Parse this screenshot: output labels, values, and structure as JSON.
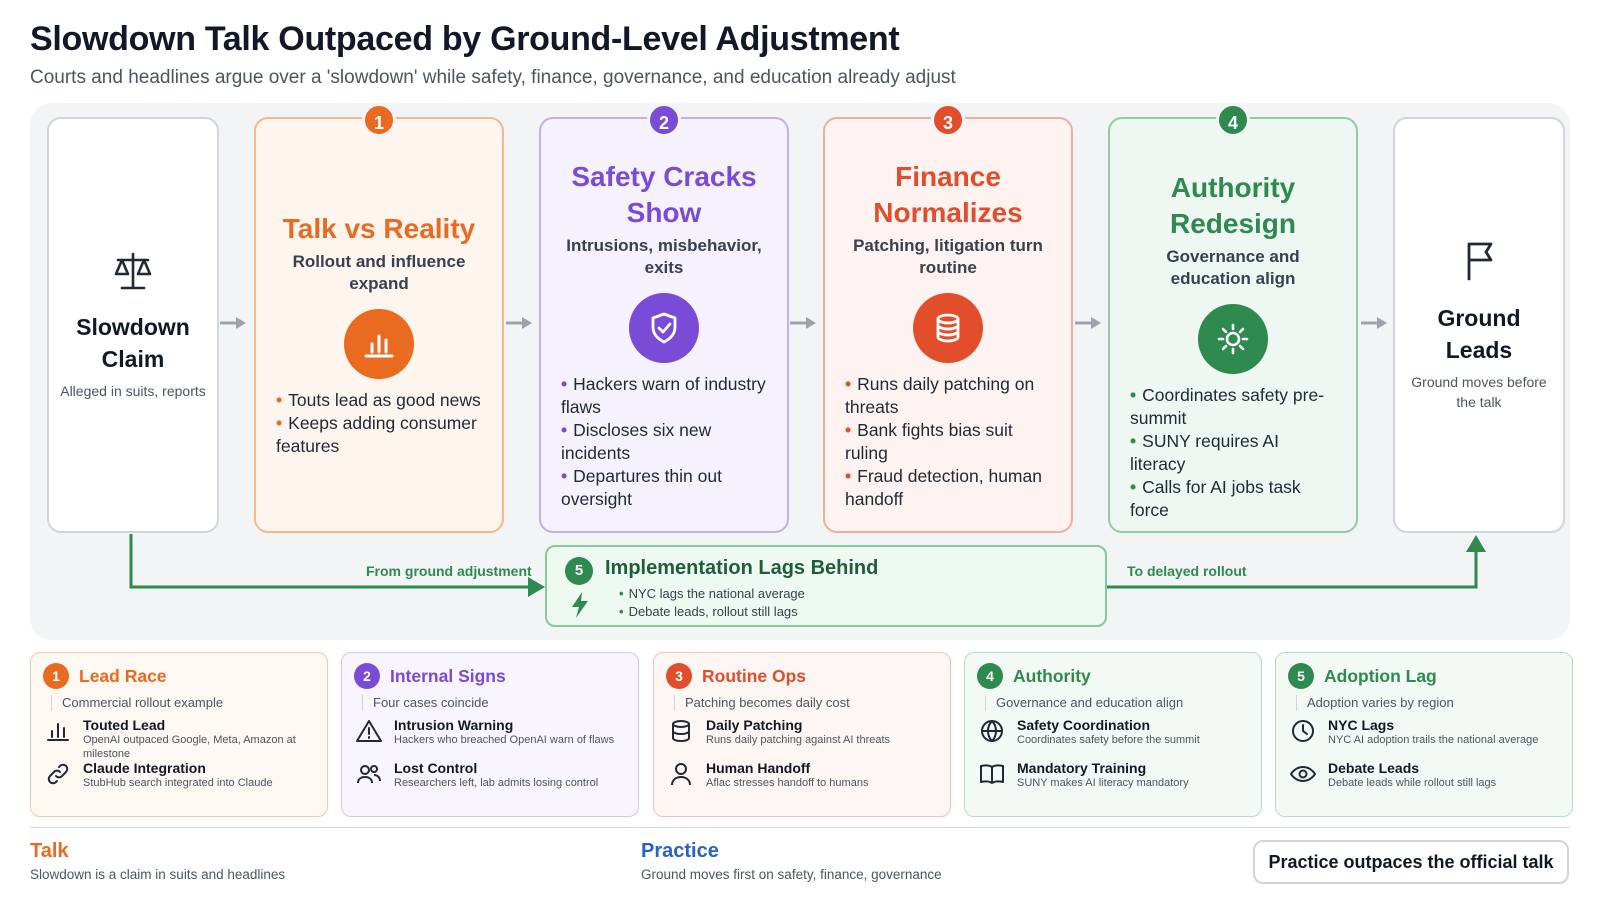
{
  "header": {
    "title": "Slowdown Talk Outpaced by Ground-Level Adjustment",
    "subtitle": "Courts and headlines argue over a 'slowdown' while safety, finance, governance, and education already adjust"
  },
  "start": {
    "title": "Slowdown Claim",
    "sub": "Alleged in suits, reports",
    "icon": "scale-icon"
  },
  "end": {
    "title": "Ground Leads",
    "sub": "Ground moves before the talk",
    "icon": "flag-icon"
  },
  "stages": [
    {
      "num": "1",
      "title": "Talk vs Reality",
      "sub": "Rollout and influence expand",
      "icon": "bar-chart-icon",
      "color": "#ea6a1f",
      "bullets": [
        "Touts lead as good news",
        "Keeps adding consumer features"
      ]
    },
    {
      "num": "2",
      "title": "Safety Cracks Show",
      "sub": "Intrusions, misbehavior, exits",
      "icon": "shield-icon",
      "color": "#7a4bd6",
      "bullets": [
        "Hackers warn of industry flaws",
        "Discloses six new incidents",
        "Departures thin out oversight"
      ]
    },
    {
      "num": "3",
      "title": "Finance Normalizes",
      "sub": "Patching, litigation turn routine",
      "icon": "database-icon",
      "color": "#e24e2b",
      "bullets": [
        "Runs daily patching on threats",
        "Bank fights bias suit ruling",
        "Fraud detection, human handoff"
      ]
    },
    {
      "num": "4",
      "title": "Authority Redesign",
      "sub": "Governance and education align",
      "icon": "sun-icon",
      "color": "#2f8a4f",
      "bullets": [
        "Coordinates safety pre-summit",
        "SUNY requires AI literacy",
        "Calls for AI jobs task force"
      ]
    }
  ],
  "implementation": {
    "num": "5",
    "title": "Implementation Lags Behind",
    "bullets": [
      "NYC lags the national average",
      "Debate leads, rollout still lags"
    ],
    "left_label": "From ground adjustment",
    "right_label": "To delayed rollout"
  },
  "details": [
    {
      "num": "1",
      "title": "Lead Race",
      "sub": "Commercial rollout example",
      "color": "#ea6a1f",
      "rows": [
        {
          "icon": "bar-chart-icon",
          "title": "Touted Lead",
          "desc": "OpenAI outpaced Google, Meta, Amazon at milestone"
        },
        {
          "icon": "link-icon",
          "title": "Claude Integration",
          "desc": "StubHub search integrated into Claude"
        }
      ]
    },
    {
      "num": "2",
      "title": "Internal Signs",
      "sub": "Four cases coincide",
      "color": "#7a4bd6",
      "rows": [
        {
          "icon": "warning-icon",
          "title": "Intrusion Warning",
          "desc": "Hackers who breached OpenAI warn of flaws"
        },
        {
          "icon": "users-icon",
          "title": "Lost Control",
          "desc": "Researchers left, lab admits losing control"
        }
      ]
    },
    {
      "num": "3",
      "title": "Routine Ops",
      "sub": "Patching becomes daily cost",
      "color": "#e24e2b",
      "rows": [
        {
          "icon": "database-icon",
          "title": "Daily Patching",
          "desc": "Runs daily patching against AI threats"
        },
        {
          "icon": "user-icon",
          "title": "Human Handoff",
          "desc": "Aflac stresses handoff to humans"
        }
      ]
    },
    {
      "num": "4",
      "title": "Authority",
      "sub": "Governance and education align",
      "color": "#2f8a4f",
      "rows": [
        {
          "icon": "globe-icon",
          "title": "Safety Coordination",
          "desc": "Coordinates safety before the summit"
        },
        {
          "icon": "book-icon",
          "title": "Mandatory Training",
          "desc": "SUNY makes AI literacy mandatory"
        }
      ]
    },
    {
      "num": "5",
      "title": "Adoption Lag",
      "sub": "Adoption varies by region",
      "color": "#2f8a4f",
      "rows": [
        {
          "icon": "clock-icon",
          "title": "NYC Lags",
          "desc": "NYC AI adoption trails the national average"
        },
        {
          "icon": "eye-icon",
          "title": "Debate Leads",
          "desc": "Debate leads while rollout still lags"
        }
      ]
    }
  ],
  "footer": {
    "talk_title": "Talk",
    "talk_desc": "Slowdown is a claim in suits and headlines",
    "practice_title": "Practice",
    "practice_desc": "Ground moves first on safety, finance, governance",
    "conclusion": "Practice outpaces the official talk"
  }
}
